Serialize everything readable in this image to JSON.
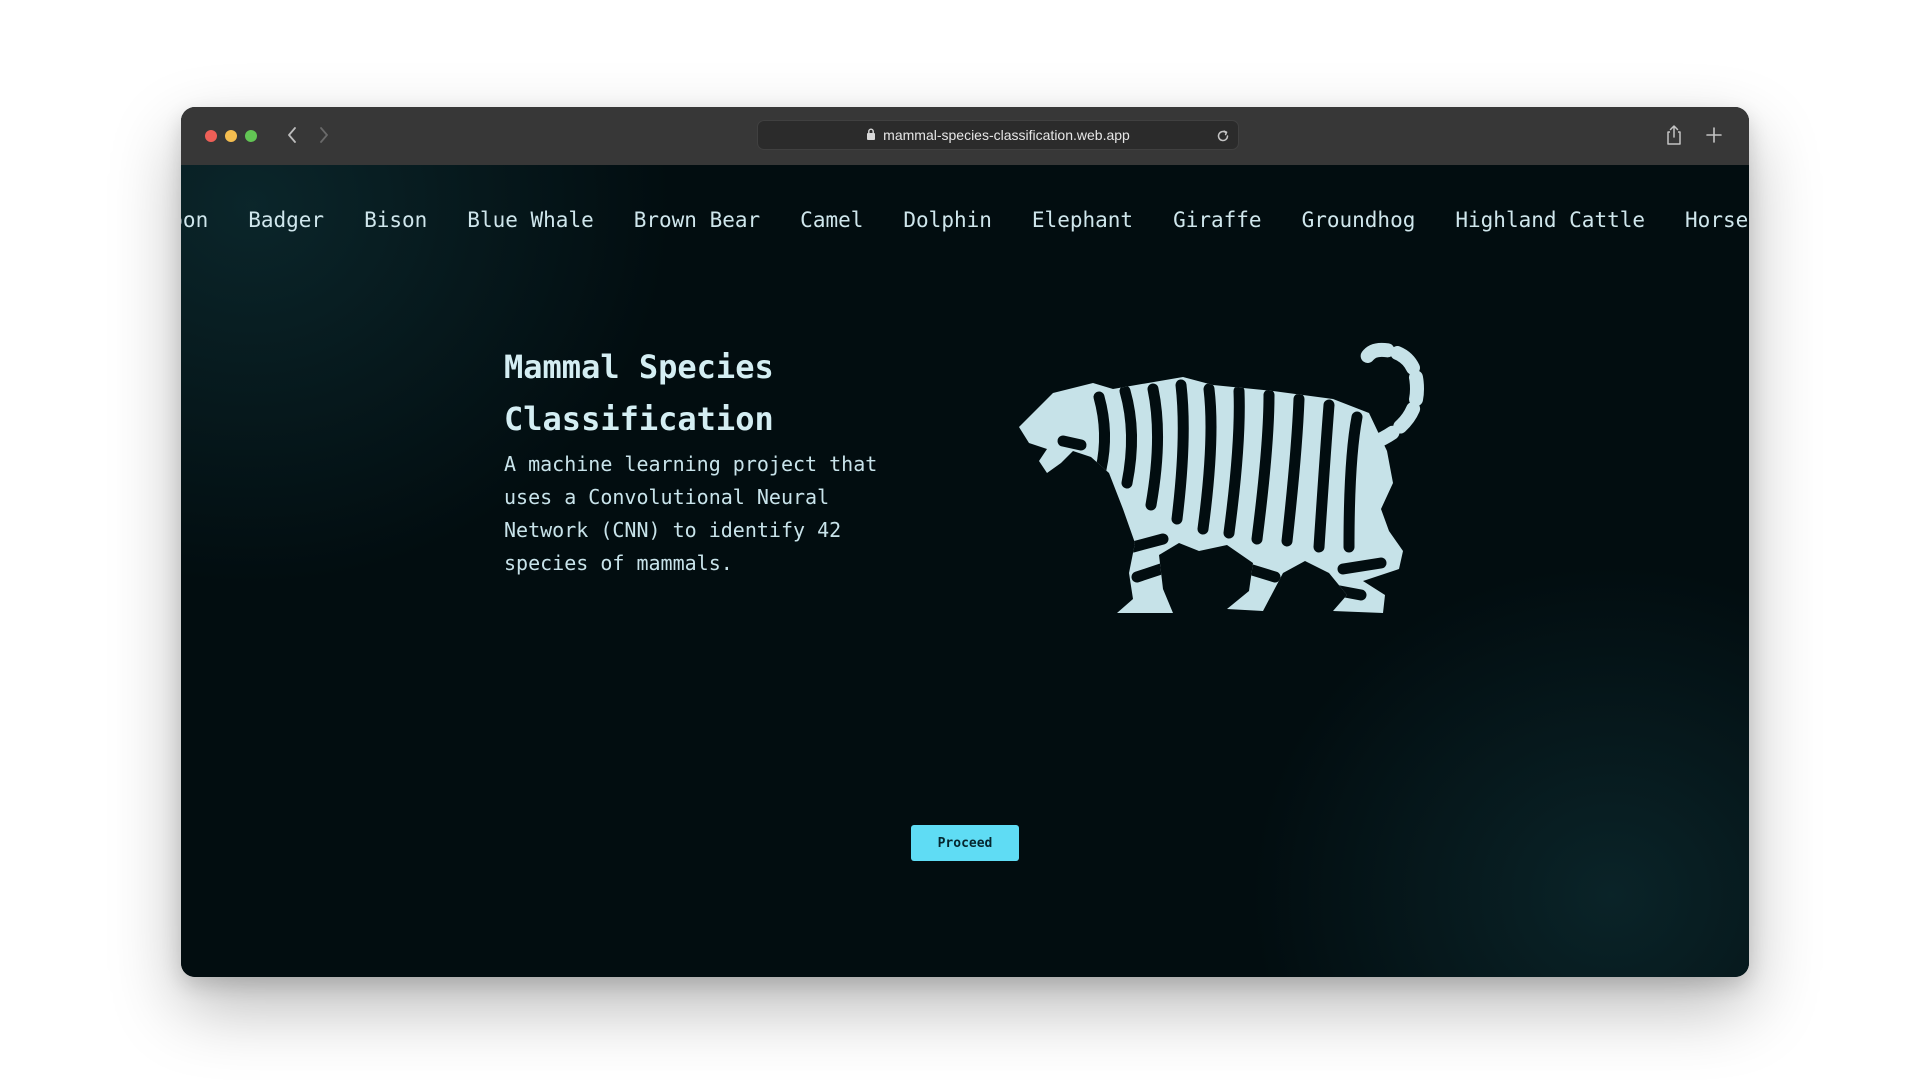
{
  "browser": {
    "url": "mammal-species-classification.web.app"
  },
  "nav": {
    "species": [
      "aboon",
      "Badger",
      "Bison",
      "Blue Whale",
      "Brown Bear",
      "Camel",
      "Dolphin",
      "Elephant",
      "Giraffe",
      "Groundhog",
      "Highland Cattle",
      "Horse"
    ]
  },
  "hero": {
    "title": "Mammal Species Classification",
    "description": "A machine learning project that uses a Convolutional Neural Network (CNN) to identify 42 species of mammals."
  },
  "actions": {
    "proceed_label": "Proceed"
  },
  "colors": {
    "background": "#020d10",
    "accent": "#5fdcf4",
    "text": "#cfe6ec",
    "tiger": "#c6e2e8",
    "titlebar": "#373737"
  },
  "icons": {
    "browser": [
      "close-icon",
      "minimize-icon",
      "maximize-icon",
      "back-arrow-icon",
      "forward-arrow-icon",
      "lock-icon",
      "reload-icon",
      "share-icon",
      "plus-icon"
    ],
    "hero": "tiger-icon"
  }
}
